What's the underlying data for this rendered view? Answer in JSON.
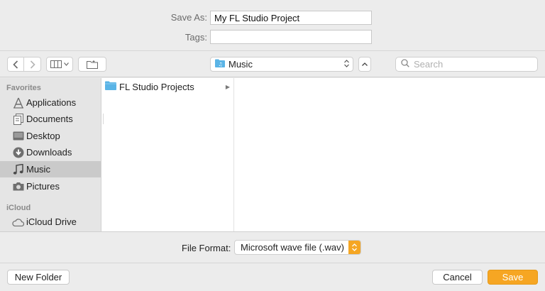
{
  "save_as": {
    "label": "Save As:",
    "value": "My FL Studio Project"
  },
  "tags": {
    "label": "Tags:",
    "value": ""
  },
  "toolbar": {
    "back_icon": "chevron-left-icon",
    "forward_icon": "chevron-right-icon",
    "view_icon": "columns-view-icon",
    "new_folder_icon": "folder-icon",
    "location": "Music",
    "search_placeholder": "Search"
  },
  "sidebar": {
    "favorites_heading": "Favorites",
    "favorites": [
      {
        "label": "Applications",
        "icon": "applications-icon"
      },
      {
        "label": "Documents",
        "icon": "documents-icon"
      },
      {
        "label": "Desktop",
        "icon": "desktop-icon"
      },
      {
        "label": "Downloads",
        "icon": "downloads-icon"
      },
      {
        "label": "Music",
        "icon": "music-note-icon",
        "selected": true
      },
      {
        "label": "Pictures",
        "icon": "camera-icon"
      }
    ],
    "icloud_heading": "iCloud",
    "icloud": [
      {
        "label": "iCloud Drive",
        "icon": "cloud-icon"
      }
    ]
  },
  "browser": {
    "items": [
      {
        "label": "FL Studio Projects",
        "type": "folder"
      }
    ]
  },
  "file_format": {
    "label": "File Format:",
    "value": "Microsoft wave file (.wav)"
  },
  "buttons": {
    "new_folder": "New Folder",
    "cancel": "Cancel",
    "save": "Save"
  },
  "colors": {
    "accent": "#f6a623",
    "folder": "#5ab4e6",
    "selection": "#cacaca"
  }
}
